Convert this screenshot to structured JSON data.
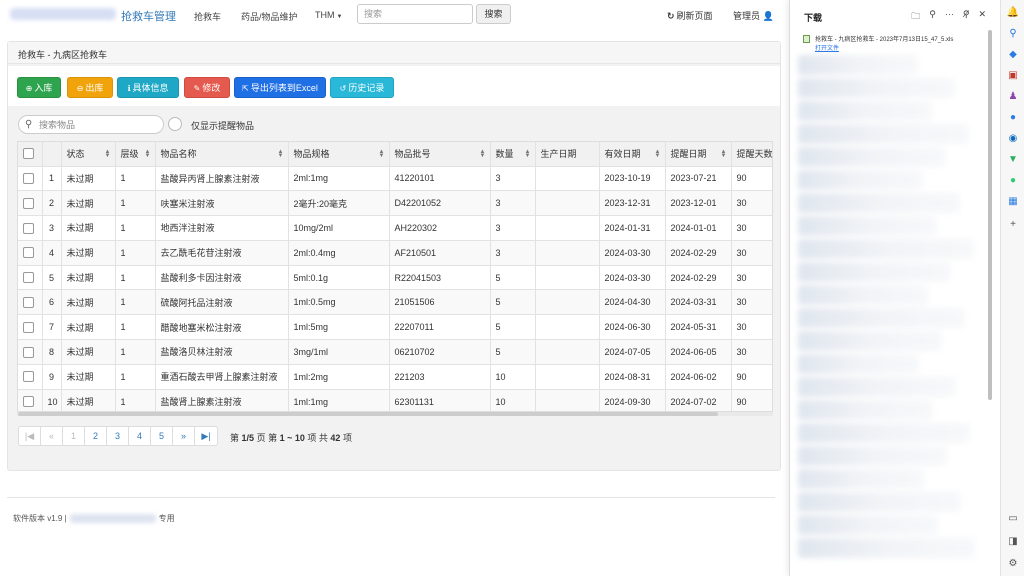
{
  "navbar": {
    "brand": "抢救车管理",
    "links": [
      "抢救车",
      "药品/物品维护",
      "THM"
    ],
    "search_placeholder": "搜索",
    "search_button": "搜索",
    "refresh": "刷新页面",
    "user": "管理员"
  },
  "panel": {
    "breadcrumb": "抢救车 - 九病区抢救车",
    "toolbar": {
      "in": "入库",
      "out": "出库",
      "detail": "具体信息",
      "edit": "修改",
      "export": "导出列表到Excel",
      "history": "历史记录"
    },
    "filter": {
      "search_placeholder": "搜索物品",
      "toggle_label": "仅显示提醒物品"
    }
  },
  "table": {
    "headers": [
      "状态",
      "层级",
      "物品名称",
      "物品规格",
      "物品批号",
      "数量",
      "生产日期",
      "有效日期",
      "提醒日期",
      "提醒天数"
    ],
    "rows": [
      {
        "n": "1",
        "status": "未过期",
        "level": "1",
        "name": "盐酸异丙肾上腺素注射液",
        "spec": "2ml:1mg",
        "batch": "41220101",
        "qty": "3",
        "prod": "",
        "exp": "2023-10-19",
        "remind": "2023-07-21",
        "days": "90"
      },
      {
        "n": "2",
        "status": "未过期",
        "level": "1",
        "name": "呋塞米注射液",
        "spec": "2毫升:20毫克",
        "batch": "D42201052",
        "qty": "3",
        "prod": "",
        "exp": "2023-12-31",
        "remind": "2023-12-01",
        "days": "30"
      },
      {
        "n": "3",
        "status": "未过期",
        "level": "1",
        "name": "地西泮注射液",
        "spec": "10mg/2ml",
        "batch": "AH220302",
        "qty": "3",
        "prod": "",
        "exp": "2024-01-31",
        "remind": "2024-01-01",
        "days": "30"
      },
      {
        "n": "4",
        "status": "未过期",
        "level": "1",
        "name": "去乙酰毛花苷注射液",
        "spec": "2ml:0.4mg",
        "batch": "AF210501",
        "qty": "3",
        "prod": "",
        "exp": "2024-03-30",
        "remind": "2024-02-29",
        "days": "30"
      },
      {
        "n": "5",
        "status": "未过期",
        "level": "1",
        "name": "盐酸利多卡因注射液",
        "spec": "5ml:0.1g",
        "batch": "R22041503",
        "qty": "5",
        "prod": "",
        "exp": "2024-03-30",
        "remind": "2024-02-29",
        "days": "30"
      },
      {
        "n": "6",
        "status": "未过期",
        "level": "1",
        "name": "硫酸阿托品注射液",
        "spec": "1ml:0.5mg",
        "batch": "21051506",
        "qty": "5",
        "prod": "",
        "exp": "2024-04-30",
        "remind": "2024-03-31",
        "days": "30"
      },
      {
        "n": "7",
        "status": "未过期",
        "level": "1",
        "name": "醋酸地塞米松注射液",
        "spec": "1ml:5mg",
        "batch": "22207011",
        "qty": "5",
        "prod": "",
        "exp": "2024-06-30",
        "remind": "2024-05-31",
        "days": "30"
      },
      {
        "n": "8",
        "status": "未过期",
        "level": "1",
        "name": "盐酸洛贝林注射液",
        "spec": "3mg/1ml",
        "batch": "06210702",
        "qty": "5",
        "prod": "",
        "exp": "2024-07-05",
        "remind": "2024-06-05",
        "days": "30"
      },
      {
        "n": "9",
        "status": "未过期",
        "level": "1",
        "name": "重酒石酸去甲肾上腺素注射液",
        "spec": "1ml:2mg",
        "batch": "221203",
        "qty": "10",
        "prod": "",
        "exp": "2024-08-31",
        "remind": "2024-06-02",
        "days": "90"
      },
      {
        "n": "10",
        "status": "未过期",
        "level": "1",
        "name": "盐酸肾上腺素注射液",
        "spec": "1ml:1mg",
        "batch": "62301131",
        "qty": "10",
        "prod": "",
        "exp": "2024-09-30",
        "remind": "2024-07-02",
        "days": "90"
      }
    ]
  },
  "pagination": {
    "pages": [
      "1",
      "2",
      "3",
      "4",
      "5"
    ],
    "info_prefix": "第",
    "page_current": "1/5",
    "info_mid1": "页  第",
    "range": "1 ~ 10",
    "info_mid2": "项  共",
    "total": "42",
    "info_suffix": "项"
  },
  "footer": {
    "version": "软件版本 v1.9 |",
    "suffix": "专用"
  },
  "downloads": {
    "title": "下载",
    "file_name": "抢救车 - 九病区抢救车 - 2023年7月13日15_47_5.xls",
    "open_link": "打开文件"
  },
  "colors": {
    "brand": "#337ab7",
    "ok_status": "#2e9e3a",
    "btn_in": "#2ea44f",
    "btn_out": "#f0a30a",
    "btn_detail": "#1fa8c6",
    "btn_edit": "#e55a4e",
    "btn_export": "#1f6fe5",
    "btn_history": "#29b8d8"
  }
}
